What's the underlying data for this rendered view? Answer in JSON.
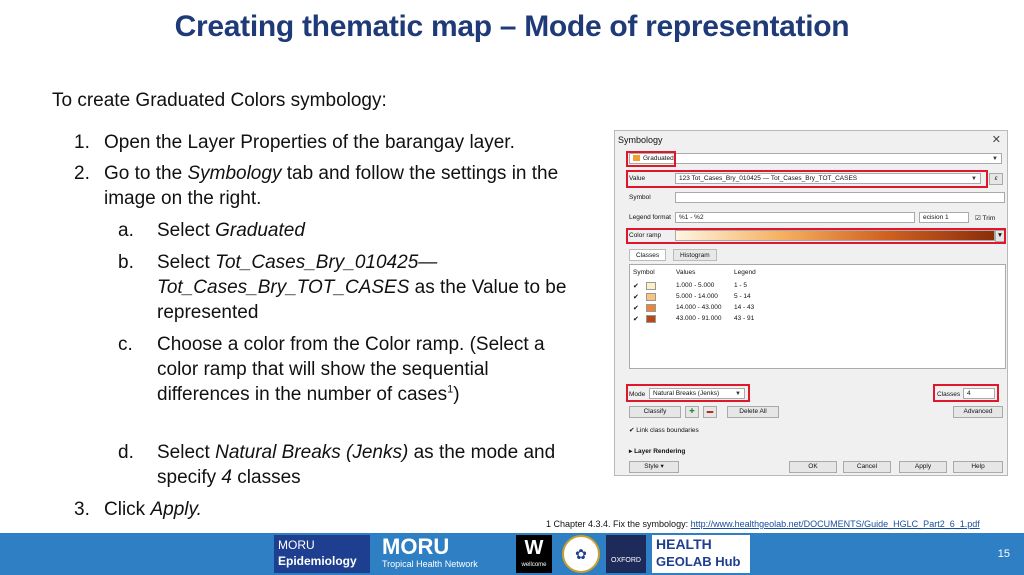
{
  "title": "Creating thematic map – Mode of representation",
  "intro": "To create Graduated Colors symbology:",
  "steps": [
    {
      "num": "1.",
      "text": "Open the Layer Properties of the barangay layer."
    },
    {
      "num": "2.",
      "text_a": "Go to the ",
      "text_i": "Symbology",
      "text_b": " tab and follow the settings in the image on the right."
    },
    {
      "num": "3.",
      "text_a": "Click ",
      "text_i": "Apply."
    }
  ],
  "substeps": [
    {
      "num": "a.",
      "text_a": "Select ",
      "text_i": "Graduated"
    },
    {
      "num": "b.",
      "text_a": "Select ",
      "text_i": "Tot_Cases_Bry_010425— Tot_Cases_Bry_TOT_CASES",
      "text_b": " as the Value to be represented"
    },
    {
      "num": "c.",
      "text": "Choose a color from the Color ramp. (Select a color ramp that will show the sequential differences in the number of cases",
      "sup": "1",
      "tail": ")"
    },
    {
      "num": "d.",
      "text_a": "Select ",
      "text_i": "Natural Breaks (Jenks)",
      "text_b": " as the mode and specify ",
      "text_i2": "4",
      "text_c": " classes"
    }
  ],
  "footnote": {
    "prefix": "1 Chapter 4.3.4. Fix the symbology: ",
    "link": "http://www.healthgeolab.net/DOCUMENTS/Guide_HGLC_Part2_6_1.pdf"
  },
  "page_number": "15",
  "logos": {
    "moru_epi_top": "MORU",
    "moru_epi_bottom": "Epidemiology",
    "moru_top": "MORU",
    "moru_bottom": "Tropical Health Network",
    "wellcome_letter": "W",
    "wellcome_word": "wellcome",
    "oxford": "OXFORD",
    "hg_top": "HEALTH",
    "hg_bottom": "GEOLAB Hub"
  },
  "dialog": {
    "title": "Symbology",
    "renderer": "Graduated",
    "value_label": "Value",
    "value_text": "123 Tot_Cases_Bry_010425 — Tot_Cases_Bry_TOT_CASES",
    "symbol_label": "Symbol",
    "legend_format_label": "Legend format",
    "legend_format_value": "%1 - %2",
    "precision_value": "ecision 1",
    "trim_label": "Trim",
    "color_ramp_label": "Color ramp",
    "tabs": [
      "Classes",
      "Histogram"
    ],
    "columns": [
      "Symbol",
      "Values",
      "Legend"
    ],
    "classes": [
      {
        "values": "1.000 - 5.000",
        "legend": "1 - 5",
        "color": "#fdf0c8"
      },
      {
        "values": "5.000 - 14.000",
        "legend": "5 - 14",
        "color": "#f7c484"
      },
      {
        "values": "14.000 - 43.000",
        "legend": "14 - 43",
        "color": "#e9863a"
      },
      {
        "values": "43.000 - 91.000",
        "legend": "43 - 91",
        "color": "#b5491a"
      }
    ],
    "mode_label": "Mode",
    "mode_value": "Natural Breaks (Jenks)",
    "classes_label": "Classes",
    "classes_value": "4",
    "classify_label": "Classify",
    "delete_all_label": "Delete All",
    "advanced_label": "Advanced",
    "link_label": "Link class boundaries",
    "layer_rendering_label": "Layer Rendering",
    "style_label": "Style",
    "ok_label": "OK",
    "cancel_label": "Cancel",
    "apply_label": "Apply",
    "help_label": "Help"
  },
  "colors": {
    "title": "#1f3a78",
    "footer": "#2f7fc4",
    "highlight": "#e0162b"
  }
}
